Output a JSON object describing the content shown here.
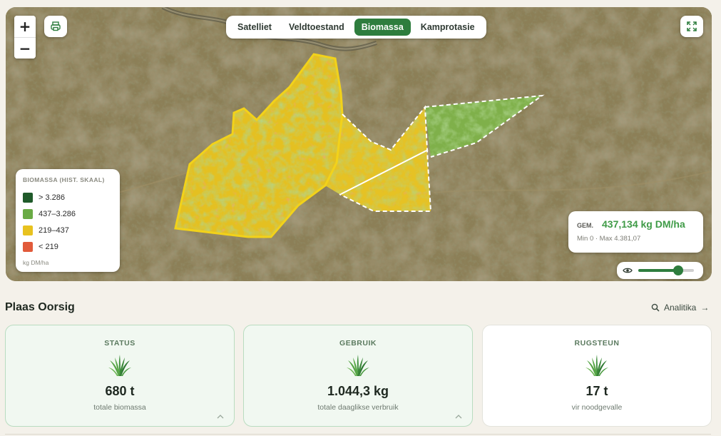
{
  "map": {
    "zoom_in": "+",
    "zoom_out": "−",
    "print_icon": "printer-icon",
    "fullscreen_icon": "expand-icon",
    "tabs": [
      {
        "label": "Satelliet",
        "active": false
      },
      {
        "label": "Veldtoestand",
        "active": false
      },
      {
        "label": "Biomassa",
        "active": true
      },
      {
        "label": "Kamprotasie",
        "active": false
      }
    ],
    "legend": {
      "title": "BIOMASSA (HIST. SKAAL)",
      "items": [
        {
          "label": "> 3.286",
          "color": "#1f5a2a"
        },
        {
          "label": "437–3.286",
          "color": "#6aab45"
        },
        {
          "label": "219–437",
          "color": "#e8c21f"
        },
        {
          "label": "< 219",
          "color": "#e15a3a"
        }
      ],
      "unit": "kg DM/ha"
    },
    "average": {
      "label": "GEM.",
      "value": "437,134 kg DM/ha",
      "minmax": "Min 0 · Max 4.381,07"
    },
    "opacity": {
      "icon": "eye-icon",
      "level": 0.72
    }
  },
  "overview": {
    "title": "Plaas Oorsig",
    "analytics_label": "Analitika",
    "analytics_arrow": "→",
    "cards": [
      {
        "title": "STATUS",
        "value": "680 t",
        "subtitle": "totale biomassa",
        "icon": "grass-icon"
      },
      {
        "title": "GEBRUIK",
        "value": "1.044,3 kg",
        "subtitle": "totale daaglikse verbruik",
        "icon": "grass-icon"
      },
      {
        "title": "RUGSTEUN",
        "value": "17 t",
        "subtitle": "vir noodgevalle",
        "icon": "grass-icon"
      }
    ]
  },
  "colors": {
    "accent": "#2e7d3e",
    "average_value": "#3f9b47"
  }
}
